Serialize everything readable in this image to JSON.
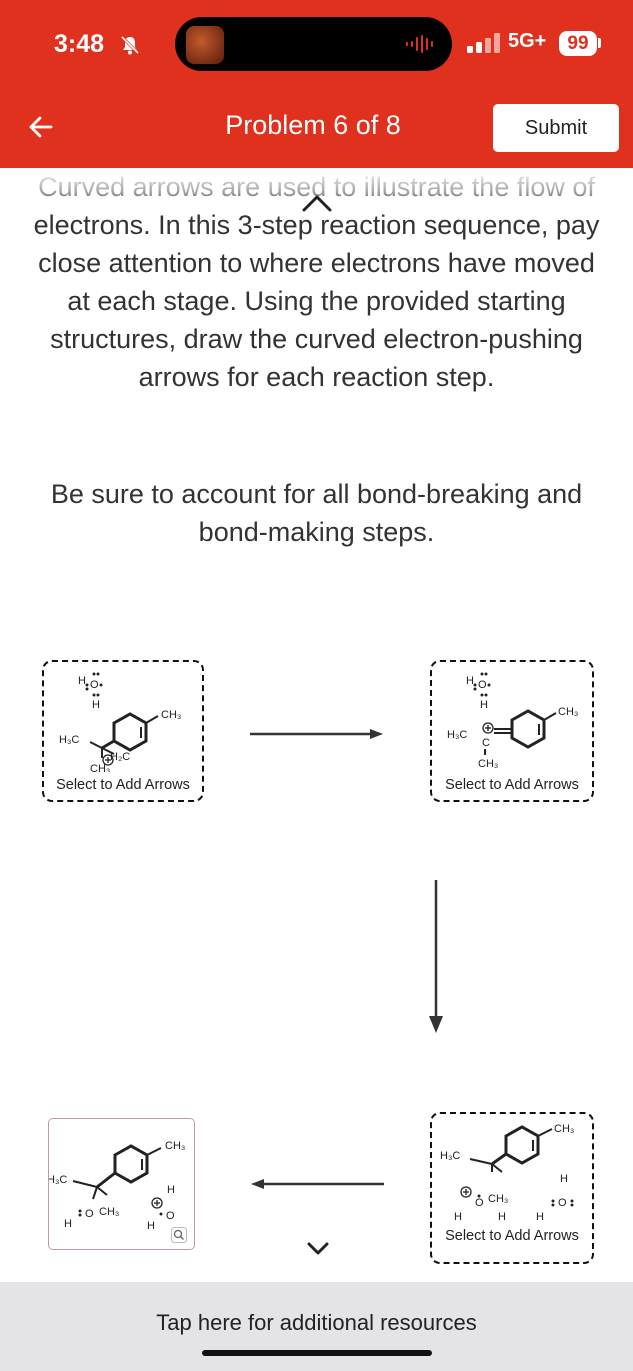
{
  "status_bar": {
    "time": "3:48",
    "network": "5G+",
    "battery": "99"
  },
  "header": {
    "title": "Problem 6 of 8",
    "submit_label": "Submit"
  },
  "instructions": {
    "paragraph1": "Curved arrows are used to illustrate the flow of electrons. In this 3-step reaction sequence, pay close attention to where electrons have moved at each stage. Using the provided starting structures, draw the curved electron-pushing arrows for each reaction step.",
    "paragraph2": "Be sure to account for all bond-breaking and bond-making steps."
  },
  "steps": {
    "step1": {
      "label": "Select to Add Arrows",
      "water": "H",
      "ch3": "CH₃",
      "h3c": "H₃C",
      "h2c": "H₂C",
      "ch3_bottom": "CH₃"
    },
    "step2": {
      "label": "Select to Add Arrows",
      "ch3": "CH₃",
      "h3c": "H₃C",
      "c": "C",
      "ch3_bottom": "CH₃"
    },
    "step3": {
      "label": "Select to Add Arrows",
      "ch3": "CH₃",
      "h3c": "H₃C",
      "och3": "CH₃"
    },
    "product": {
      "ch3": "CH₃",
      "h3c": "H₃C",
      "och3": "CH₃"
    }
  },
  "footer": {
    "resources": "Tap here for additional resources"
  },
  "colors": {
    "accent": "#e0311f",
    "bottom_bar": "#e4e4e8",
    "product_border": "#c79a9a"
  },
  "icons": [
    "bell-slash-icon",
    "back-arrow-icon",
    "signal-icon",
    "battery-icon",
    "zoom-icon",
    "chevron-down-icon"
  ]
}
